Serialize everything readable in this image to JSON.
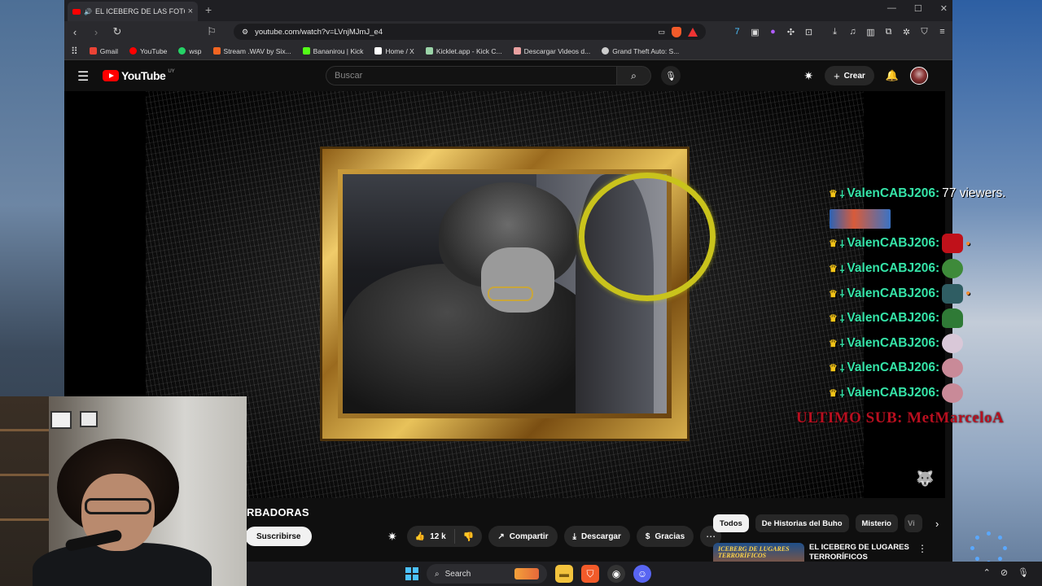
{
  "tab": {
    "title": "EL ICEBERG DE LAS FOTOS PE",
    "close": "×",
    "new_tab": "+"
  },
  "window_controls": {
    "minimize": "—",
    "maximize": "☐",
    "close": "✕"
  },
  "address_bar": {
    "url": "youtube.com/watch?v=LVnjMJmJ_e4"
  },
  "bookmarks": [
    {
      "label": "Gmail",
      "color": "#ea4335"
    },
    {
      "label": "YouTube",
      "color": "#ff0000"
    },
    {
      "label": "wsp",
      "color": "#25d366"
    },
    {
      "label": "Stream .WAV by Six...",
      "color": "#f26522"
    },
    {
      "label": "Bananirou | Kick",
      "color": "#53fc18"
    },
    {
      "label": "Home / X",
      "color": "#ffffff"
    },
    {
      "label": "Kicklet.app - Kick C...",
      "color": "#9bd4a8"
    },
    {
      "label": "Descargar Videos d...",
      "color": "#e9a0a0"
    },
    {
      "label": "Grand Theft Auto: S...",
      "color": "#cccccc"
    }
  ],
  "youtube": {
    "logo_text": "YouTube",
    "country": "UY",
    "search_placeholder": "Buscar",
    "create_label": "Crear",
    "video_title_visible": "RBADORAS",
    "subscribe_label": "Suscribirse",
    "like_count": "12 k",
    "share_label": "Compartir",
    "download_label": "Descargar",
    "thanks_label": "Gracias",
    "chips": [
      "Todos",
      "De Historias del Buho",
      "Misterio",
      "Vi"
    ],
    "recommended": {
      "thumb_text": "ICEBERG DE LUGARES TERRORÍFICOS",
      "title": "EL ICEBERG DE LUGARES TERRORÍFICOS EXPLICADO"
    }
  },
  "overlay": {
    "chat": [
      {
        "user": "ValenCABJ206:",
        "message": "77 viewers.",
        "extra": ""
      },
      {
        "user": "",
        "message": "",
        "extra": "image"
      },
      {
        "user": "ValenCABJ206:",
        "message": "",
        "extra": "emote-red"
      },
      {
        "user": "ValenCABJ206:",
        "message": "",
        "extra": "emote-green"
      },
      {
        "user": "ValenCABJ206:",
        "message": "",
        "extra": "emote-teal"
      },
      {
        "user": "ValenCABJ206:",
        "message": "",
        "extra": "emote-green2"
      },
      {
        "user": "ValenCABJ206:",
        "message": "",
        "extra": "emote-pink"
      },
      {
        "user": "ValenCABJ206:",
        "message": "",
        "extra": "emote-pink2"
      },
      {
        "user": "ValenCABJ206:",
        "message": "",
        "extra": "emote-pink3"
      }
    ],
    "last_sub": "ULTIMO SUB: MetMarceloA"
  },
  "taskbar": {
    "search_label": "Search"
  }
}
